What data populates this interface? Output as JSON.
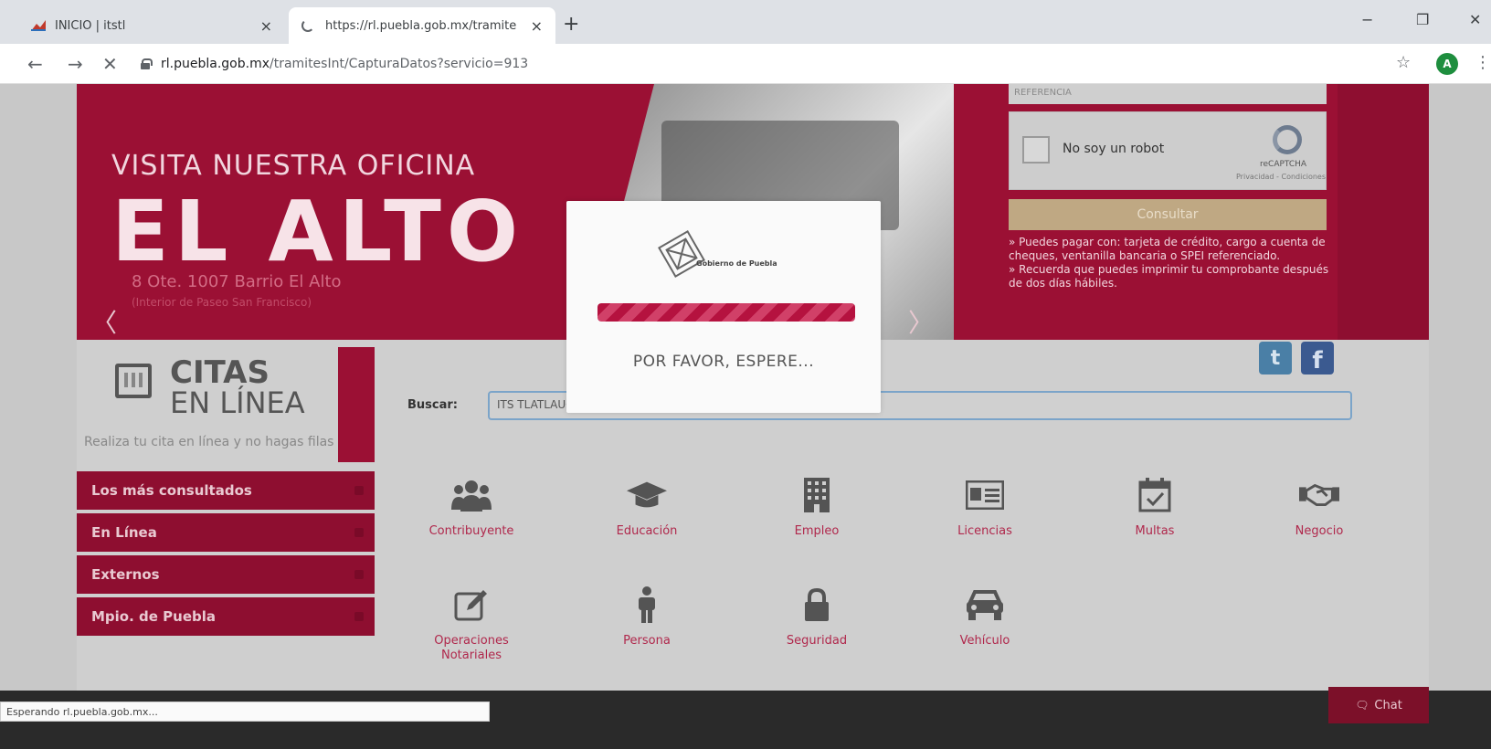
{
  "browser": {
    "tabs": [
      {
        "title": "INICIO | itstl",
        "close": "×"
      },
      {
        "title": "https://rl.puebla.gob.mx/tramite",
        "close": "×"
      }
    ],
    "new_tab": "+",
    "window_controls": {
      "minimize": "−",
      "maximize": "❐",
      "close": "✕"
    },
    "nav": {
      "back": "←",
      "forward": "→",
      "stop": "✕"
    },
    "url_host": "rl.puebla.gob.mx",
    "url_path": "/tramitesInt/CapturaDatos?servicio=913",
    "star": "☆",
    "profile_initial": "A",
    "menu": "⋮"
  },
  "banner": {
    "line1": "VISITA NUESTRA OFICINA",
    "line2": "EL ALTO",
    "address1": "8 Ote. 1007 Barrio El Alto",
    "address2": "(Interior de Paseo San Francisco)",
    "prev": "〈",
    "next": "〉"
  },
  "panel": {
    "referencia_placeholder": "REFERENCIA",
    "captcha_text": "No soy un robot",
    "captcha_brand": "reCAPTCHA",
    "captcha_terms": "Privacidad - Condiciones",
    "consult_button": "Consultar",
    "note1": "» Puedes pagar con: tarjeta de crédito, cargo a cuenta de cheques, ventanilla bancaria o SPEI referenciado.",
    "note2": "» Recuerda que puedes imprimir tu comprobante después de dos días hábiles."
  },
  "citas": {
    "title1": "CITAS",
    "title2": "EN LÍNEA",
    "subtitle": "Realiza tu cita en línea y no hagas filas"
  },
  "sidebar": {
    "items": [
      {
        "label": "Los más consultados"
      },
      {
        "label": "En Línea"
      },
      {
        "label": "Externos"
      },
      {
        "label": "Mpio. de Puebla"
      }
    ]
  },
  "social": {
    "twitter": "t",
    "facebook": "f"
  },
  "search": {
    "label": "Buscar:",
    "value": "ITS TLATLAUQUITEPEC INSCRIPCION SEMESTRAL"
  },
  "categories": [
    {
      "label": "Contribuyente",
      "icon": "users-icon"
    },
    {
      "label": "Educación",
      "icon": "graduation-cap-icon"
    },
    {
      "label": "Empleo",
      "icon": "building-icon"
    },
    {
      "label": "Licencias",
      "icon": "id-card-icon"
    },
    {
      "label": "Multas",
      "icon": "calendar-check-icon"
    },
    {
      "label": "Negocio",
      "icon": "handshake-icon"
    },
    {
      "label": "Operaciones Notariales",
      "icon": "edit-icon"
    },
    {
      "label": "Persona",
      "icon": "person-icon"
    },
    {
      "label": "Seguridad",
      "icon": "lock-icon"
    },
    {
      "label": "Vehículo",
      "icon": "car-icon"
    }
  ],
  "loading": {
    "org": "Gobierno de Puebla",
    "progress": 1.0,
    "message": "POR FAVOR, ESPERE..."
  },
  "status_bar": "Esperando rl.puebla.gob.mx...",
  "chat": "Chat",
  "colors": {
    "accent": "#9b1034",
    "accent_dark": "#8e0e30"
  }
}
